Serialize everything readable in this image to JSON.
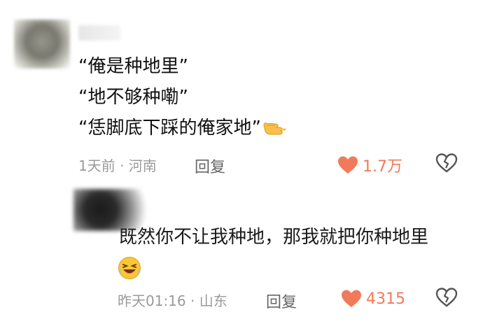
{
  "comments": [
    {
      "lines": [
        "“俺是种地里”",
        "“地不够种嘞”",
        "“恁脚底下踩的俺家地”"
      ],
      "meta": "1天前 · 河南",
      "reply_label": "回复",
      "like_count": "1.7万"
    },
    {
      "lines": [
        "既然你不让我种地，那我就把你种地里"
      ],
      "meta": "昨天01:16 · 山东",
      "reply_label": "回复",
      "like_count": "4315"
    }
  ],
  "colors": {
    "like": "#f07a59",
    "meta": "#9a9a9a",
    "text": "#111111"
  },
  "icons": {
    "like": "heart-icon",
    "dislike": "broken-heart-icon",
    "emoji_point": "pointing-hand-emoji",
    "emoji_laugh": "laughing-face-emoji"
  }
}
